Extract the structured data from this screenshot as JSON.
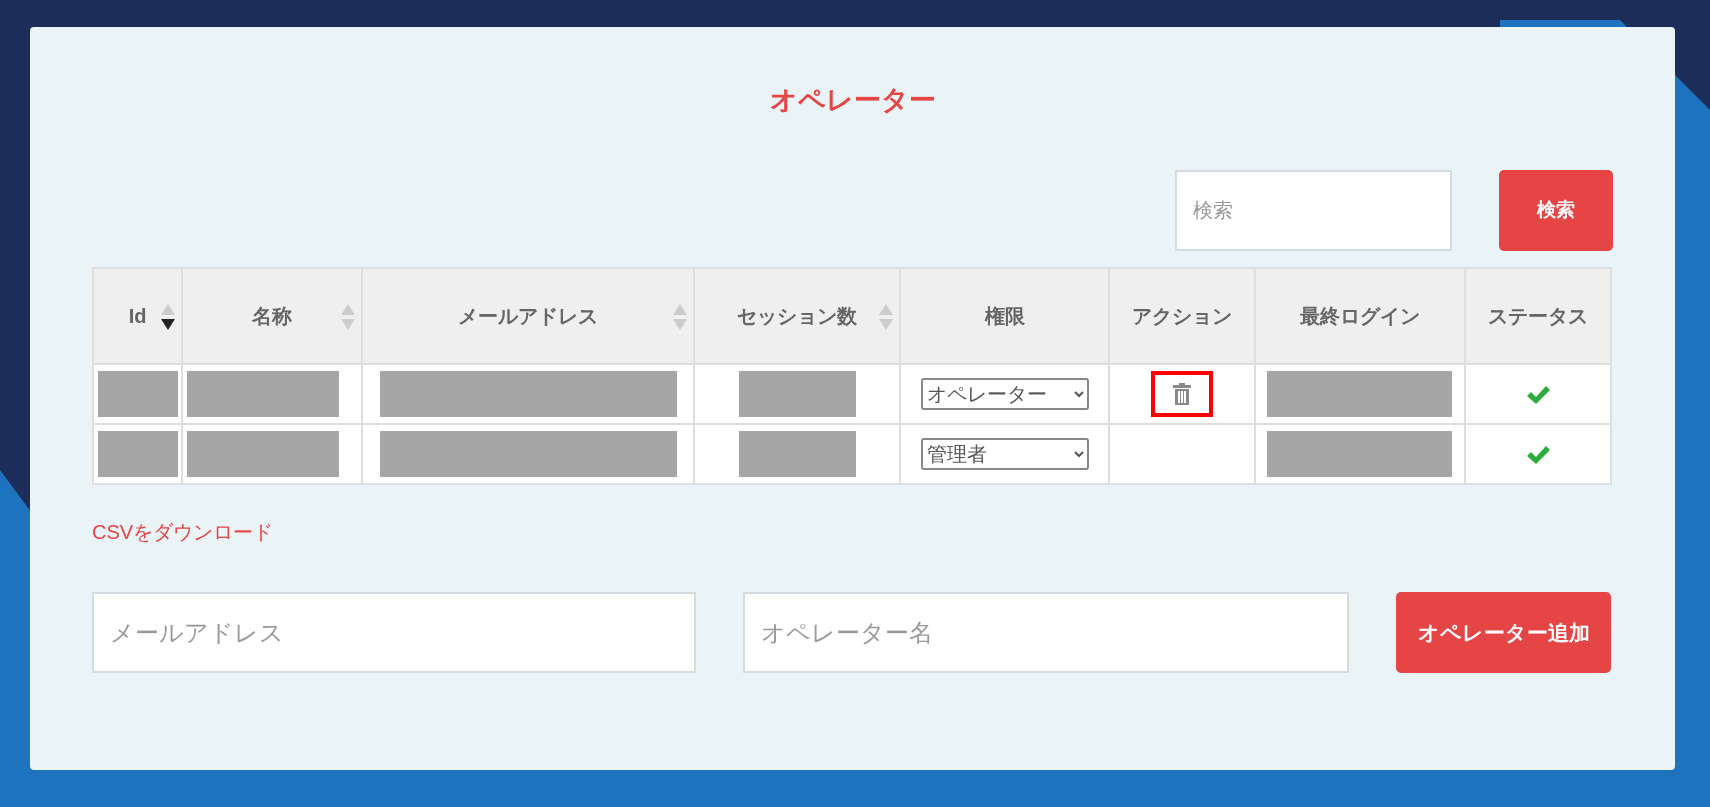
{
  "title": "オペレーター",
  "search": {
    "placeholder": "検索",
    "button": "検索"
  },
  "table": {
    "columns": [
      {
        "label": "Id",
        "sortable": true,
        "sorted_descending": true
      },
      {
        "label": "名称",
        "sortable": true,
        "sorted_descending": false
      },
      {
        "label": "メールアドレス",
        "sortable": true,
        "sorted_descending": false
      },
      {
        "label": "セッション数",
        "sortable": true,
        "sorted_descending": false
      },
      {
        "label": "権限"
      },
      {
        "label": "アクション"
      },
      {
        "label": "最終ログイン"
      },
      {
        "label": "ステータス"
      }
    ],
    "rows": [
      {
        "role": "オペレーター",
        "delete_action": true,
        "action_highlighted": true,
        "active": true
      },
      {
        "role": "管理者",
        "delete_action": false,
        "active": true
      }
    ]
  },
  "csv_link": "CSVをダウンロード",
  "add_form": {
    "email_placeholder": "メールアドレス",
    "name_placeholder": "オペレーター名",
    "button": "オペレーター追加"
  }
}
